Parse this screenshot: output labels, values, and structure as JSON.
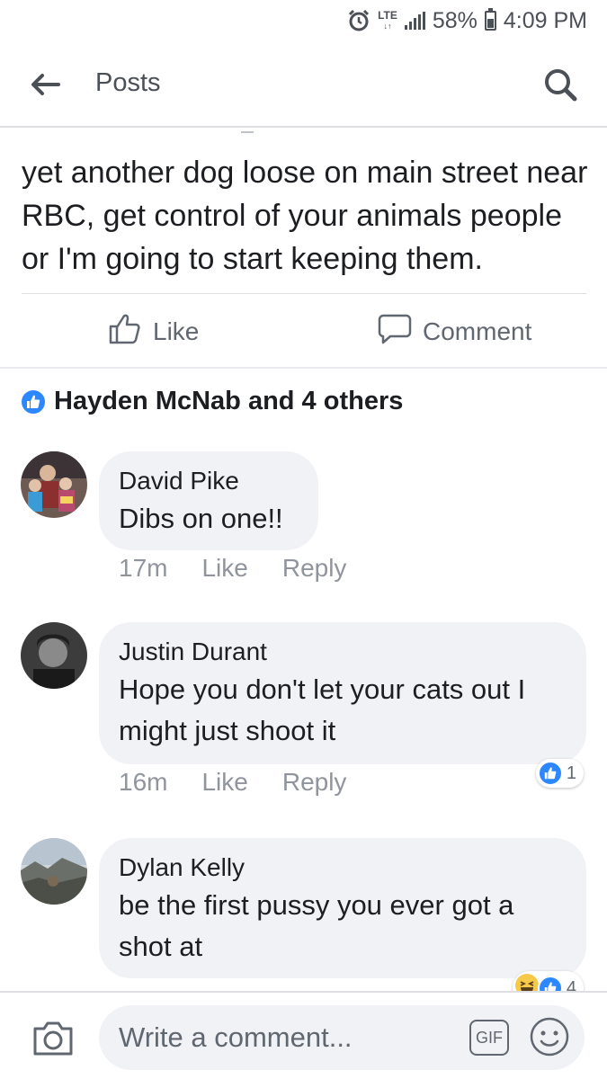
{
  "status_bar": {
    "network": "LTE",
    "battery": "58%",
    "battery_level": 0.58,
    "time": "4:09 PM"
  },
  "header": {
    "title": "Posts"
  },
  "post": {
    "text": "yet another dog loose on main street near RBC, get control of your animals people or I'm going to start keeping them.",
    "like_label": "Like",
    "comment_label": "Comment"
  },
  "reactions": {
    "summary": "Hayden McNab and 4 others"
  },
  "comments": [
    {
      "author": "David Pike",
      "text": "Dibs on one!!",
      "time": "17m",
      "like_label": "Like",
      "reply_label": "Reply",
      "avatar_icon": "family-photo-avatar"
    },
    {
      "author": "Justin Durant",
      "text": "Hope you don't let your cats out I might just shoot it",
      "time": "16m",
      "like_label": "Like",
      "reply_label": "Reply",
      "reaction_count": "1",
      "avatar_icon": "man-portrait-avatar"
    },
    {
      "author": "Dylan Kelly",
      "text": "be the first pussy you ever got a shot at",
      "avatar_icon": "landscape-photo-avatar",
      "reaction_count": "4"
    }
  ],
  "composer": {
    "placeholder": "Write a comment...",
    "gif_label": "GIF"
  },
  "colors": {
    "facebook_blue": "#2d88ff",
    "bubble_gray": "#f0f2f5",
    "meta_gray": "#90949c"
  }
}
